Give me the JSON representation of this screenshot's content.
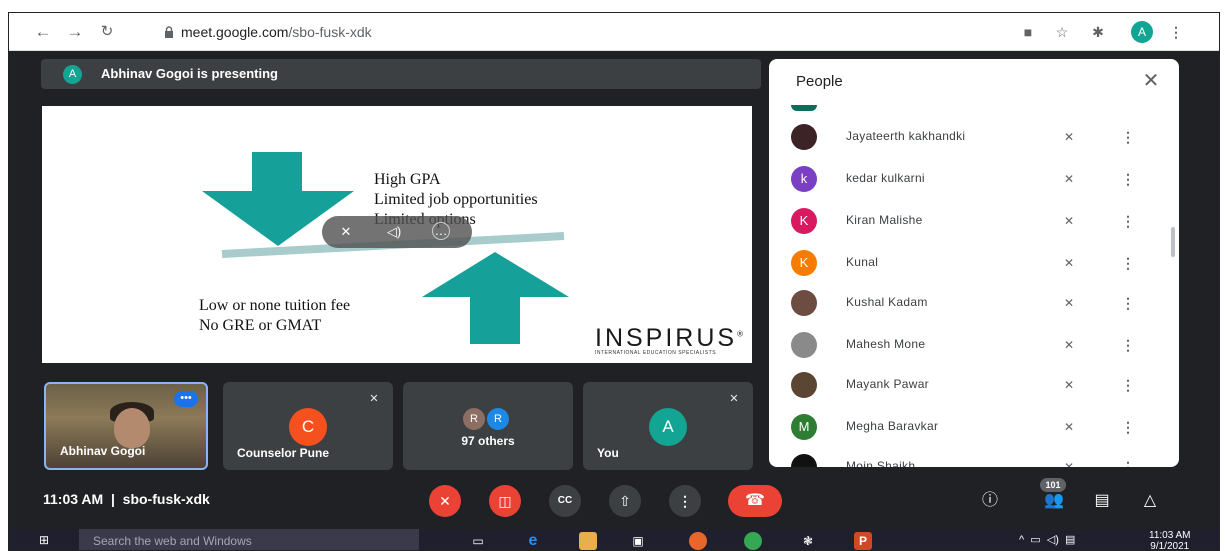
{
  "browser": {
    "url_host": "meet.google.com",
    "url_path": "/sbo-fusk-xdk",
    "profile_initial": "A",
    "back_icon": "arrow-left-icon",
    "forward_icon": "arrow-right-icon",
    "reload_icon": "reload-icon"
  },
  "presenting": {
    "avatar_initial": "A",
    "text": "Abhinav Gogoi is presenting"
  },
  "slide": {
    "lines_top": [
      "High GPA",
      "Limited job opportunities",
      "Limited options"
    ],
    "lines_bottom": [
      "Low or none tuition fee",
      "No GRE or GMAT"
    ],
    "brand": "INSPIRUS",
    "brand_mark": "®",
    "brand_tagline": "INTERNATIONAL EDUCATION SPECIALISTS",
    "arrow_color": "#16a09a"
  },
  "tiles": [
    {
      "name": "Abhinav Gogoi"
    },
    {
      "name": "Counselor Pune",
      "initial": "C",
      "color": "#f4511e"
    },
    {
      "label": "97 others",
      "initials": [
        "R",
        "R"
      ],
      "colors": [
        "#8d6e63",
        "#1e88e5"
      ]
    },
    {
      "name": "You",
      "initial": "A",
      "color": "#12a594"
    }
  ],
  "bottom": {
    "time": "11:03 AM",
    "separator": "|",
    "meeting_code": "sbo-fusk-xdk",
    "participant_count": "101"
  },
  "people": {
    "title": "People",
    "list": [
      {
        "name": "Jayateerth kakhandki",
        "initial": "",
        "color": "#3b2326"
      },
      {
        "name": "kedar kulkarni",
        "initial": "k",
        "color": "#7b3fc4"
      },
      {
        "name": "Kiran Malishe",
        "initial": "K",
        "color": "#d81b60"
      },
      {
        "name": "Kunal",
        "initial": "K",
        "color": "#f57c00"
      },
      {
        "name": "Kushal Kadam",
        "initial": "",
        "color": "#6d4c41"
      },
      {
        "name": "Mahesh Mone",
        "initial": "",
        "color": "#8a8a8a"
      },
      {
        "name": "Mayank Pawar",
        "initial": "",
        "color": "#5a4632"
      },
      {
        "name": "Megha Baravkar",
        "initial": "M",
        "color": "#2e7d32"
      },
      {
        "name": "Moin Shaikh",
        "initial": "",
        "color": "#111111"
      }
    ]
  },
  "taskbar": {
    "search_placeholder": "Search the web and Windows",
    "clock_time": "11:03 AM",
    "clock_date": "9/1/2021"
  }
}
